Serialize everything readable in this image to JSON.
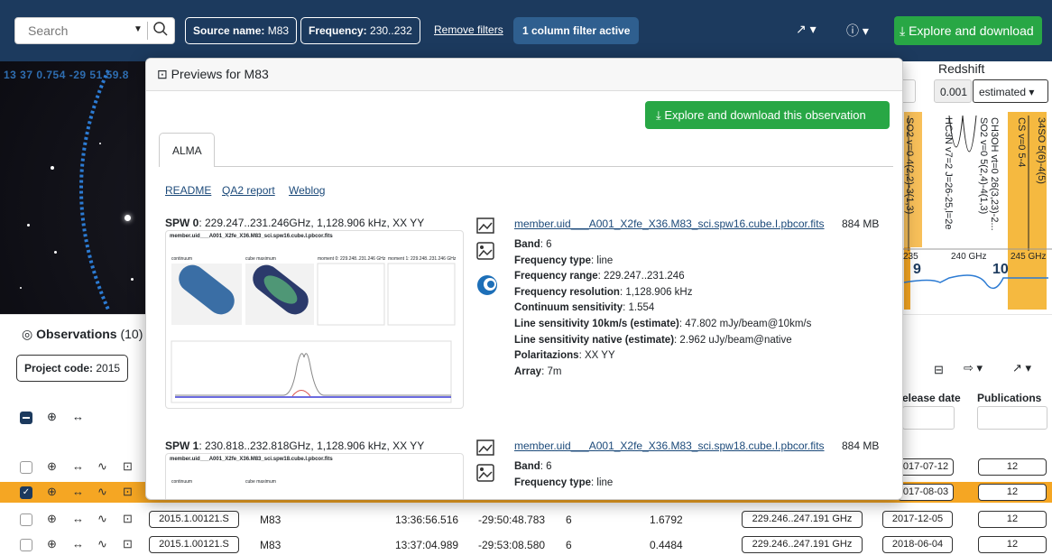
{
  "topbar": {
    "search_placeholder": "Search",
    "filter_source_key": "Source name:",
    "filter_source_val": "M83",
    "filter_freq_key": "Frequency:",
    "filter_freq_val": "230..232",
    "remove_filters": "Remove filters",
    "column_filter": "1 column filter active",
    "explore_download": "Explore and download"
  },
  "sky": {
    "coords": "13 37 0.754 -29 51 59.8"
  },
  "spectrum": {
    "redshift_label": "Redshift",
    "redshift_value": "0.001",
    "redshift_mode": "estimated",
    "lines": [
      "SO2 v=0 4(2,2)-3(1,3)",
      "HC3N v7=2 J=26-25,l=2e",
      "SO2 v=0 5(2,4)-4(1,3)",
      "CH3OH vt=0 26(3,23)-2...",
      "CS v=0 5-4",
      "34SO 5(6)-4(5)"
    ],
    "ticks": [
      "235 GHz",
      "240 GHz",
      "245 GHz"
    ],
    "bands": [
      "9",
      "10"
    ]
  },
  "observations": {
    "title": "Observations",
    "count": "(10)",
    "project_filter_key": "Project code:",
    "project_filter_val": "2015",
    "release_header": "elease date",
    "pub_header": "Publications",
    "rows": [
      {
        "project": "",
        "source": "",
        "ra": "",
        "dec": "",
        "band": "",
        "res": "",
        "freq": "",
        "release": "017-07-12",
        "pubs": "12",
        "checked": false,
        "highlight": false
      },
      {
        "project": "",
        "source": "",
        "ra": "",
        "dec": "",
        "band": "",
        "res": "",
        "freq": "",
        "release": "017-08-03",
        "pubs": "12",
        "checked": true,
        "highlight": true
      },
      {
        "project": "2015.1.00121.S",
        "source": "M83",
        "ra": "13:36:56.516",
        "dec": "-29:50:48.783",
        "band": "6",
        "res": "1.6792",
        "freq": "229.246..247.191 GHz",
        "release": "2017-12-05",
        "pubs": "12",
        "checked": false,
        "highlight": false
      },
      {
        "project": "2015.1.00121.S",
        "source": "M83",
        "ra": "13:37:04.989",
        "dec": "-29:53:08.580",
        "band": "6",
        "res": "0.4484",
        "freq": "229.246..247.191 GHz",
        "release": "2018-06-04",
        "pubs": "12",
        "checked": false,
        "highlight": false
      }
    ]
  },
  "modal": {
    "title": "Previews for M83",
    "explore_obs": "Explore and download this observation",
    "tab": "ALMA",
    "links": [
      "README",
      "QA2 report",
      "Weblog"
    ],
    "spw": [
      {
        "label": "SPW 0",
        "desc": ": 229.247..231.246GHz, 1,128.906 kHz, XX YY",
        "thumb_title": "member.uid___A001_X2fe_X36.M83_sci.spw16.cube.I.pbcor.fits",
        "thumb_panels": [
          "continuum",
          "cube maximum",
          "moment 0: 229.248..231.246 GHz",
          "moment 1: 229.248..231.246 GHz"
        ],
        "file": "member.uid___A001_X2fe_X36.M83_sci.spw16.cube.I.pbcor.fits",
        "size": "884 MB",
        "props": [
          {
            "k": "Band",
            "v": ": 6"
          },
          {
            "k": "Frequency type",
            "v": ": line"
          },
          {
            "k": "Frequency range",
            "v": ": 229.247..231.246"
          },
          {
            "k": "Frequency resolution",
            "v": ": 1,128.906 kHz"
          },
          {
            "k": "Continuum sensitivity",
            "v": ": 1.554"
          },
          {
            "k": "Line sensitivity 10km/s (estimate)",
            "v": ": 47.802 mJy/beam@10km/s"
          },
          {
            "k": "Line sensitivity native (estimate)",
            "v": ": 2.962 uJy/beam@native"
          },
          {
            "k": "Polaritazions",
            "v": ": XX YY"
          },
          {
            "k": "Array",
            "v": ": 7m"
          }
        ]
      },
      {
        "label": "SPW 1",
        "desc": ": 230.818..232.818GHz, 1,128.906 kHz, XX YY",
        "thumb_title": "member.uid___A001_X2fe_X36.M83_sci.spw18.cube.I.pbcor.fits",
        "thumb_panels": [
          "continuum",
          "cube maximum"
        ],
        "file": "member.uid___A001_X2fe_X36.M83_sci.spw18.cube.I.pbcor.fits",
        "size": "884 MB",
        "props": [
          {
            "k": "Band",
            "v": ": 6"
          },
          {
            "k": "Frequency type",
            "v": ": line"
          }
        ]
      }
    ]
  }
}
